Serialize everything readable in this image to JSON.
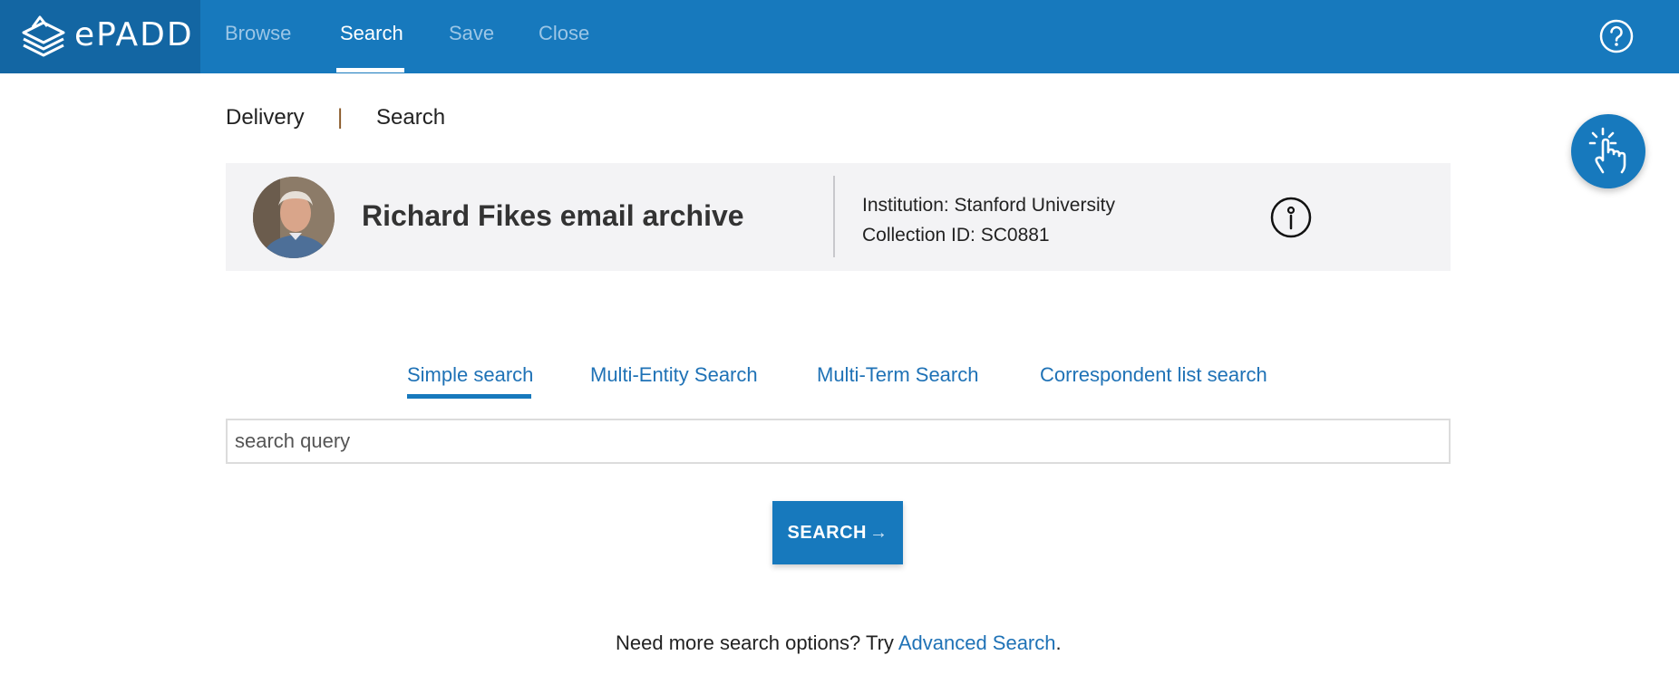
{
  "app": {
    "logo_text": "ePADD"
  },
  "nav": {
    "items": [
      {
        "label": "Browse"
      },
      {
        "label": "Search"
      },
      {
        "label": "Save"
      },
      {
        "label": "Close"
      }
    ],
    "active": "Search"
  },
  "breadcrumb": {
    "items": [
      "Delivery",
      "Search"
    ],
    "separator": "|"
  },
  "archive": {
    "title": "Richard Fikes email archive",
    "institution": "Institution: Stanford University",
    "collection_id": "Collection ID: SC0881"
  },
  "tabs": [
    {
      "label": "Simple search",
      "active": true
    },
    {
      "label": "Multi-Entity Search"
    },
    {
      "label": "Multi-Term Search"
    },
    {
      "label": "Correspondent list search"
    }
  ],
  "search": {
    "placeholder": "search query",
    "value": "",
    "button_label": "SEARCH",
    "button_arrow": "→"
  },
  "footer_hint": {
    "prefix": "Need more search options? Try ",
    "link": "Advanced Search",
    "suffix": "."
  },
  "colors": {
    "brand": "#1779bd",
    "brand_dark": "#1366a3",
    "card_bg": "#f3f3f5",
    "link": "#1f72b6"
  },
  "icons": [
    "epadd-logo-icon",
    "help-icon",
    "info-icon",
    "touch-hand-icon",
    "arrow-right-icon"
  ]
}
